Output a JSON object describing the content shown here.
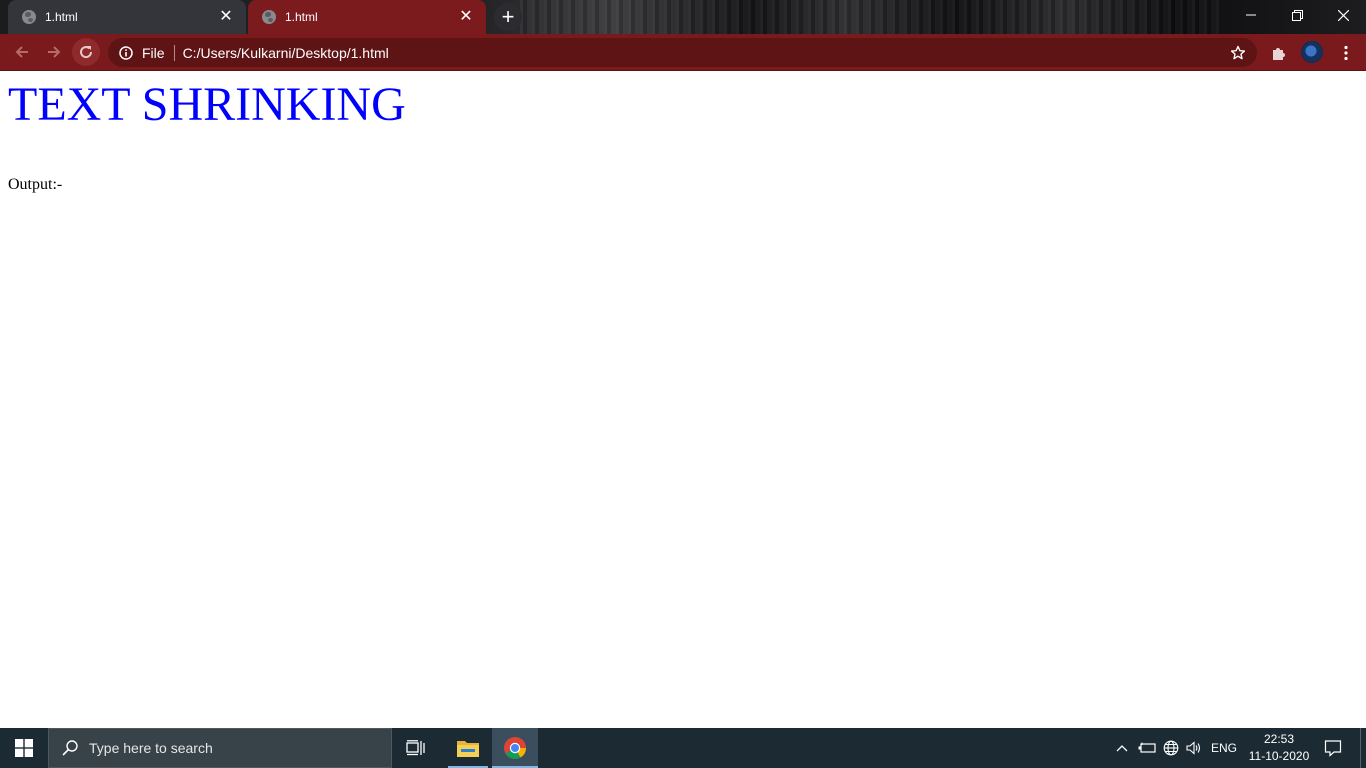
{
  "browser": {
    "tabs": [
      {
        "title": "1.html",
        "active": false
      },
      {
        "title": "1.html",
        "active": true
      }
    ],
    "omnibox": {
      "scheme_label": "File",
      "url": "C:/Users/Kulkarni/Desktop/1.html"
    },
    "theme_color": "#7a1a1c"
  },
  "page": {
    "heading": "TEXT SHRINKING",
    "heading_color": "#0000ff",
    "output_label": "Output:-"
  },
  "taskbar": {
    "search_placeholder": "Type here to search",
    "pinned_apps": [
      "task-view",
      "file-explorer",
      "google-chrome"
    ],
    "language": "ENG",
    "time": "22:53",
    "date": "11-10-2020"
  }
}
